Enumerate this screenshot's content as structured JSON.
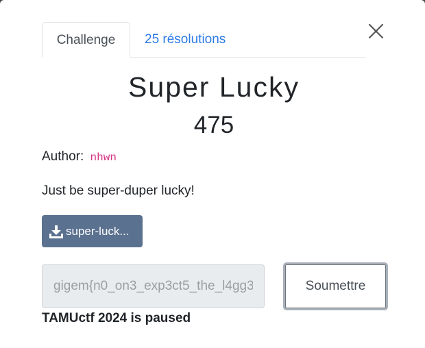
{
  "tabs": {
    "challenge_label": "Challenge",
    "solves_label": "25 résolutions"
  },
  "challenge": {
    "name": "Super Lucky",
    "points": "475",
    "author_label": "Author:",
    "author_name": "nhwn",
    "description": "Just be super-duper lucky!",
    "file_label": "super-luck..."
  },
  "flag": {
    "value": "gigem{n0_on3_exp3ct5_the_l4gg3",
    "submit_label": "Soumettre"
  },
  "status": {
    "message": "TAMUctf 2024 is paused"
  },
  "icons": {
    "close": "close-icon",
    "download": "download-icon"
  },
  "colors": {
    "link": "#2c7be5",
    "file_button": "#5b7190",
    "author_code": "#d63384"
  }
}
